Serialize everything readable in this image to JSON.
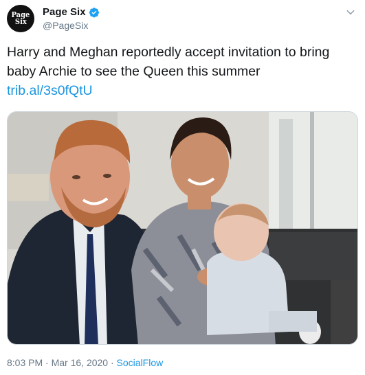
{
  "tweet": {
    "display_name": "Page Six",
    "handle": "@PageSix",
    "avatar_text_line1": "Page",
    "avatar_text_line2": "Six",
    "text": "Harry and Meghan reportedly accept invitation to bring baby Archie to see the Queen this summer",
    "link": "trib.al/3s0fQtU",
    "time": "8:03 PM",
    "separator": "·",
    "date": "Mar 16, 2020",
    "source": "SocialFlow"
  },
  "icons": {
    "verified": "verified-badge-icon",
    "more": "chevron-down-icon"
  },
  "colors": {
    "link": "#1b95e0",
    "verified": "#1da1f2",
    "secondary_text": "#657786"
  }
}
